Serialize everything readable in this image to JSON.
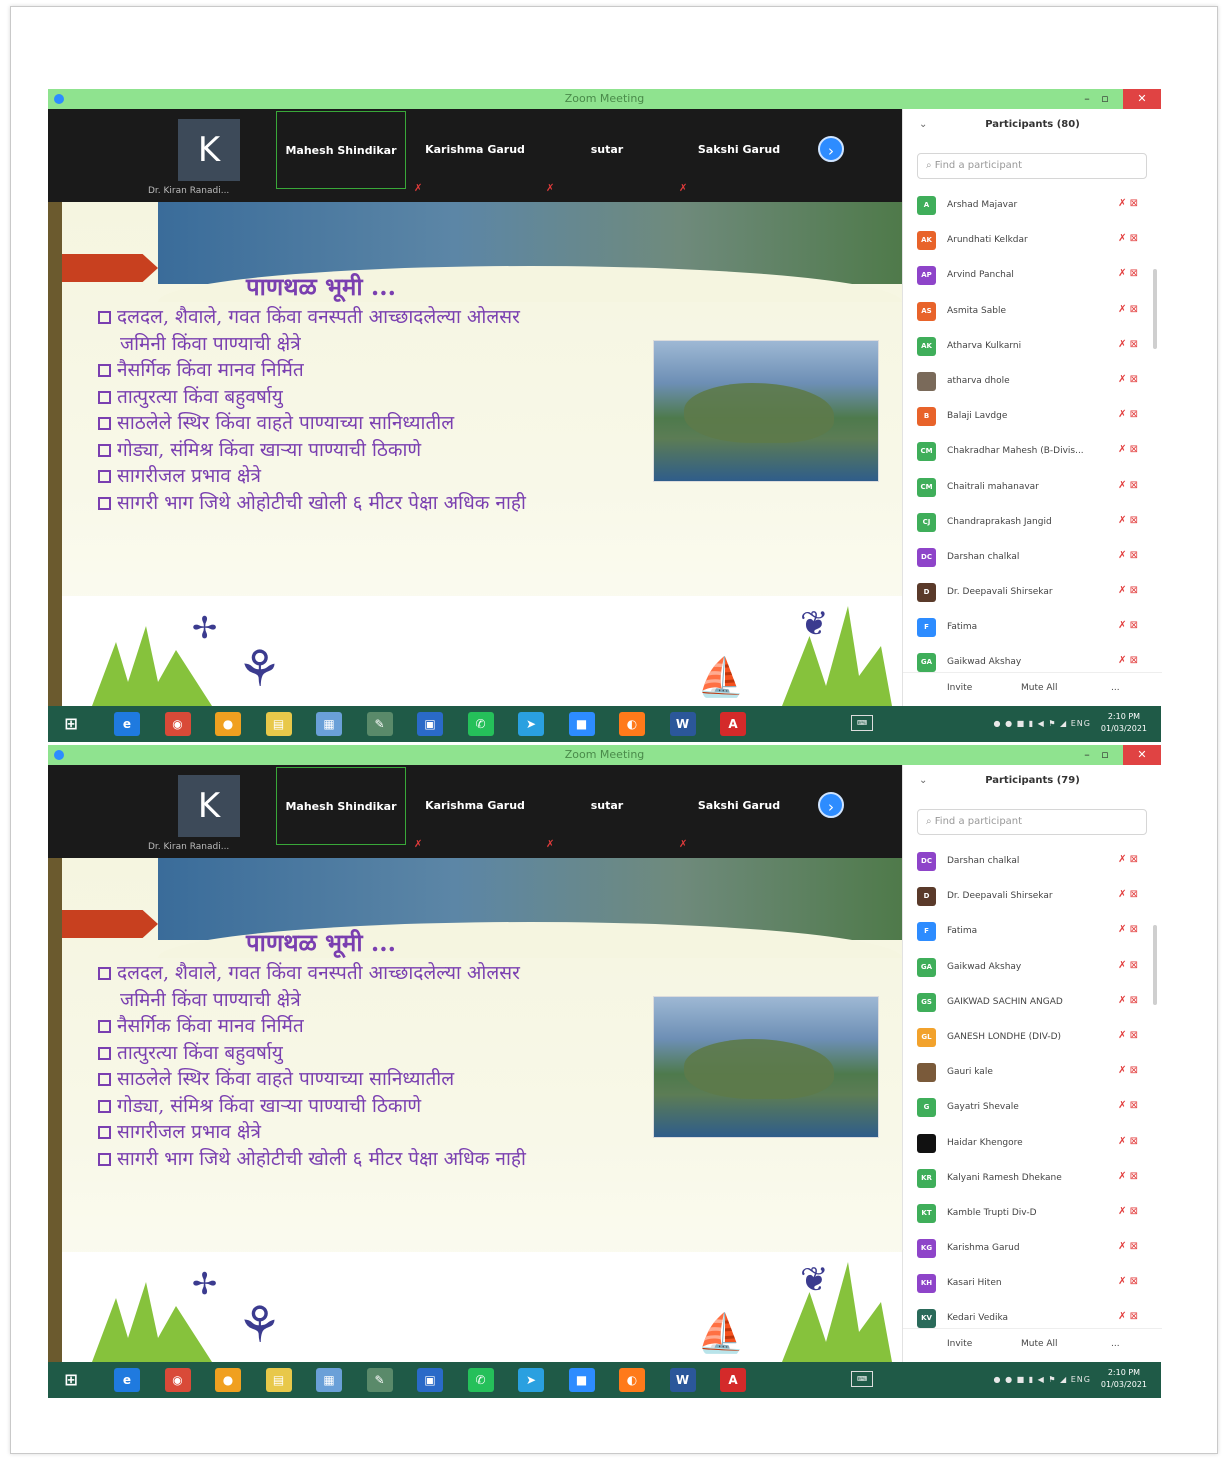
{
  "screens": [
    {
      "window_title": "Zoom Meeting",
      "participants_title": "Participants (80)",
      "participants": [
        {
          "initials": "A",
          "name": "Arshad Majavar",
          "color": "#3fae5a"
        },
        {
          "initials": "AK",
          "name": "Arundhati Kelkdar",
          "color": "#e8632a"
        },
        {
          "initials": "AP",
          "name": "Arvind Panchal",
          "color": "#8e44c9"
        },
        {
          "initials": "AS",
          "name": "Asmita Sable",
          "color": "#e8632a"
        },
        {
          "initials": "AK",
          "name": "Atharva Kulkarni",
          "color": "#3fae5a"
        },
        {
          "initials": "",
          "name": "atharva dhole",
          "color": "#7a6a5a"
        },
        {
          "initials": "B",
          "name": "Balaji Lavdge",
          "color": "#e8632a"
        },
        {
          "initials": "CM",
          "name": "Chakradhar Mahesh (B-Divis...",
          "color": "#3fae5a"
        },
        {
          "initials": "CM",
          "name": "Chaitrali mahanavar",
          "color": "#3fae5a"
        },
        {
          "initials": "CJ",
          "name": "Chandraprakash Jangid",
          "color": "#3fae5a"
        },
        {
          "initials": "DC",
          "name": "Darshan chalkal",
          "color": "#8e44c9"
        },
        {
          "initials": "D",
          "name": "Dr. Deepavali Shirsekar",
          "color": "#5a3a2a"
        },
        {
          "initials": "F",
          "name": "Fatima",
          "color": "#2d8cff"
        },
        {
          "initials": "GA",
          "name": "Gaikwad Akshay",
          "color": "#3fae5a"
        }
      ]
    },
    {
      "window_title": "Zoom Meeting",
      "participants_title": "Participants (79)",
      "participants": [
        {
          "initials": "DC",
          "name": "Darshan chalkal",
          "color": "#8e44c9"
        },
        {
          "initials": "D",
          "name": "Dr. Deepavali Shirsekar",
          "color": "#5a3a2a"
        },
        {
          "initials": "F",
          "name": "Fatima",
          "color": "#2d8cff"
        },
        {
          "initials": "GA",
          "name": "Gaikwad Akshay",
          "color": "#3fae5a"
        },
        {
          "initials": "GS",
          "name": "GAIKWAD SACHIN ANGAD",
          "color": "#3fae5a"
        },
        {
          "initials": "GL",
          "name": "GANESH LONDHE (DIV-D)",
          "color": "#f2a22c"
        },
        {
          "initials": "",
          "name": "Gauri kale",
          "color": "#7a5a3a"
        },
        {
          "initials": "G",
          "name": "Gayatri Shevale",
          "color": "#3fae5a"
        },
        {
          "initials": "",
          "name": "Haidar Khengore",
          "color": "#111111"
        },
        {
          "initials": "KR",
          "name": "Kalyani Ramesh Dhekane",
          "color": "#3fae5a"
        },
        {
          "initials": "KT",
          "name": "Kamble Trupti Div-D",
          "color": "#3fae5a"
        },
        {
          "initials": "KG",
          "name": "Karishma Garud",
          "color": "#8e44c9"
        },
        {
          "initials": "KH",
          "name": "Kasari Hiten",
          "color": "#8e44c9"
        },
        {
          "initials": "KV",
          "name": "Kedari Vedika",
          "color": "#2a6a5a"
        }
      ]
    }
  ],
  "video": {
    "host_letter": "K",
    "host_name": "Dr. Kiran Ranadi...",
    "tiles": [
      "Mahesh Shindikar",
      "Karishma Garud",
      "sutar",
      "Sakshi Garud"
    ]
  },
  "slide": {
    "title": "पाणथळ भूमी ...",
    "bullets": [
      "दलदल, शैवाले, गवत किंवा वनस्पती आच्छादलेल्या ओलसर",
      "जमिनी किंवा पाण्याची क्षेत्रे",
      "नैसर्गिक किंवा मानव निर्मित",
      "तात्पुरत्या किंवा बहुवर्षायु",
      "साठलेले स्थिर किंवा वाहते पाण्याच्या सानिध्यातील",
      "गोड्या, संमिश्र किंवा खाऱ्या पाण्याची ठिकाणे",
      "सागरीजल प्रभाव क्षेत्रे",
      "सागरी भाग जिथे ओहोटीची खोली ६ मीटर पेक्षा अधिक नाही"
    ]
  },
  "panel": {
    "search_placeholder": "Find a participant",
    "invite_label": "Invite",
    "mute_all_label": "Mute All",
    "more_label": "..."
  },
  "taskbar": {
    "tray_text": "ENG",
    "time": "2:10 PM",
    "date": "01/03/2021",
    "apps": [
      {
        "name": "edge-icon",
        "glyph": "e",
        "color": "#1f7adf"
      },
      {
        "name": "chrome-icon",
        "glyph": "◉",
        "color": "#d94a38"
      },
      {
        "name": "orange-app-icon",
        "glyph": "●",
        "color": "#f0a020"
      },
      {
        "name": "file-explorer-icon",
        "glyph": "▤",
        "color": "#e8c84a"
      },
      {
        "name": "notepad-icon",
        "glyph": "▦",
        "color": "#6aa0d8"
      },
      {
        "name": "paint-icon",
        "glyph": "✎",
        "color": "#5a8a6a"
      },
      {
        "name": "photos-icon",
        "glyph": "▣",
        "color": "#2a6ac8"
      },
      {
        "name": "whatsapp-icon",
        "glyph": "✆",
        "color": "#25c05a"
      },
      {
        "name": "telegram-icon",
        "glyph": "➤",
        "color": "#2aa0e0"
      },
      {
        "name": "zoom-icon",
        "glyph": "■",
        "color": "#2d8cff"
      },
      {
        "name": "firefox-icon",
        "glyph": "◐",
        "color": "#ff7a1a"
      },
      {
        "name": "word-icon",
        "glyph": "W",
        "color": "#2b579a"
      },
      {
        "name": "acrobat-icon",
        "glyph": "A",
        "color": "#d42a2a"
      }
    ]
  }
}
